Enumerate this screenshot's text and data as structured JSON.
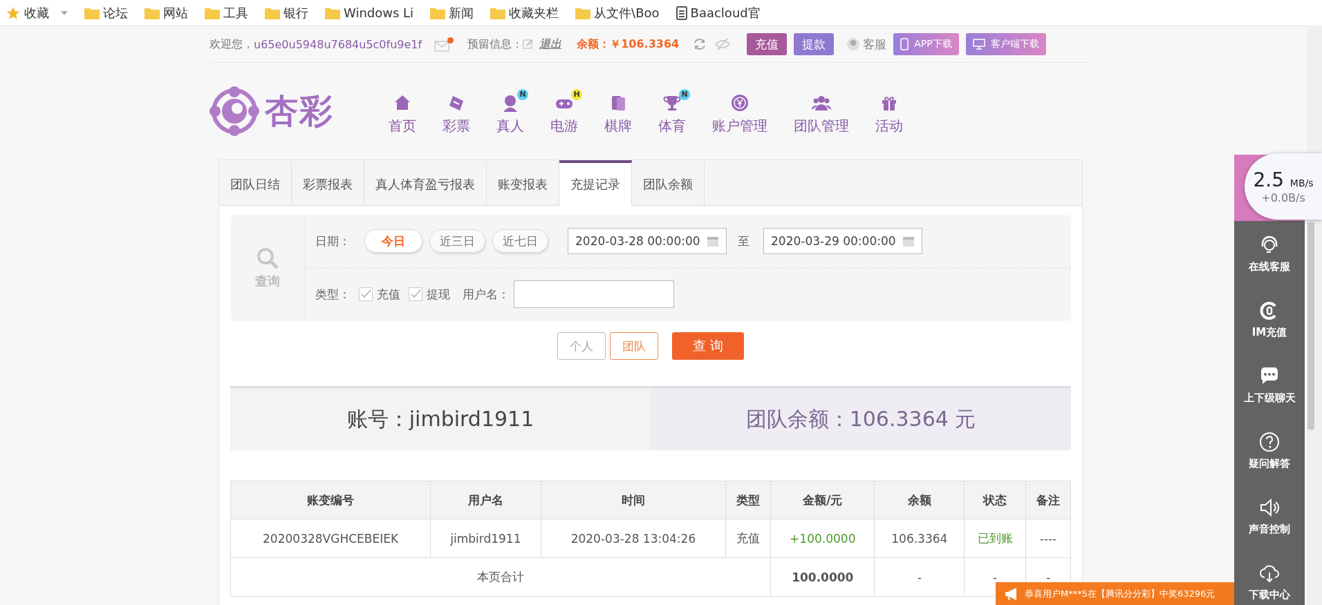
{
  "bookmarks": [
    {
      "kind": "star",
      "label": "收藏",
      "dropdown": true
    },
    {
      "kind": "folder",
      "label": "论坛",
      "dropdown": false
    },
    {
      "kind": "folder",
      "label": "网站",
      "dropdown": false
    },
    {
      "kind": "folder",
      "label": "工具",
      "dropdown": false
    },
    {
      "kind": "folder",
      "label": "银行",
      "dropdown": false
    },
    {
      "kind": "folder",
      "label": "Windows Li",
      "dropdown": false
    },
    {
      "kind": "folder",
      "label": "新闻",
      "dropdown": false
    },
    {
      "kind": "folder",
      "label": "收藏夹栏",
      "dropdown": false
    },
    {
      "kind": "folder",
      "label": "从文件\\Boo",
      "dropdown": false
    },
    {
      "kind": "page",
      "label": "Baacloud官",
      "dropdown": false
    }
  ],
  "header": {
    "welcome": "欢迎您，",
    "username": "u65e0u5948u7684u5c0fu9e1f",
    "mail_unread": true,
    "reserved_label": "预留信息：",
    "logout": "退出",
    "balance_label": "余额：",
    "balance": "￥106.3364",
    "deposit": "充值",
    "withdraw": "提款",
    "service": "客服",
    "app_download": "APP下载",
    "client_download": "客户端下载"
  },
  "logo_text": "杏彩",
  "nav": [
    {
      "label": "首页"
    },
    {
      "label": "彩票"
    },
    {
      "label": "真人",
      "badge": {
        "text": "N",
        "color": "#5bd0f0"
      }
    },
    {
      "label": "电游",
      "badge": {
        "text": "H",
        "color": "#f5e63c"
      }
    },
    {
      "label": "棋牌"
    },
    {
      "label": "体育",
      "badge": {
        "text": "N",
        "color": "#5bd0f0"
      }
    },
    {
      "label": "账户管理"
    },
    {
      "label": "团队管理"
    },
    {
      "label": "活动"
    }
  ],
  "tabs": [
    {
      "label": "团队日结",
      "selected": false
    },
    {
      "label": "彩票报表",
      "selected": false
    },
    {
      "label": "真人体育盈亏报表",
      "selected": false
    },
    {
      "label": "账变报表",
      "selected": false
    },
    {
      "label": "充提记录",
      "selected": true
    },
    {
      "label": "团队余额",
      "selected": false
    }
  ],
  "filter": {
    "search_label": "查询",
    "date_label": "日期：",
    "ranges": [
      {
        "label": "今日",
        "selected": true
      },
      {
        "label": "近三日",
        "selected": false
      },
      {
        "label": "近七日",
        "selected": false
      }
    ],
    "date_from": "2020-03-28 00:00:00",
    "to_label": "至",
    "date_to": "2020-03-29 00:00:00",
    "type_label": "类型：",
    "types": [
      {
        "label": "充值",
        "checked": true
      },
      {
        "label": "提现",
        "checked": true
      }
    ],
    "username_label": "用户名：",
    "scopes": [
      {
        "label": "个人",
        "selected": false
      },
      {
        "label": "团队",
        "selected": true
      }
    ],
    "submit": "查 询"
  },
  "summary": {
    "account": "账号：jimbird1911",
    "team_balance": "团队余额：106.3364 元"
  },
  "table": {
    "columns": [
      "账变编号",
      "用户名",
      "时间",
      "类型",
      "金额/元",
      "余额",
      "状态",
      "备注"
    ],
    "rows": [
      {
        "id": "20200328VGHCEBEIEK",
        "user": "jimbird1911",
        "time": "2020-03-28 13:04:26",
        "type": "充值",
        "amount": "+100.0000",
        "balance": "106.3364",
        "status": "已到账",
        "note": "----"
      }
    ],
    "footer": {
      "label": "本页合计",
      "amount": "100.0000",
      "balance": "-",
      "status": "-",
      "note": "-"
    }
  },
  "side_menu": [
    {
      "label": "在线客服"
    },
    {
      "label": "IM充值"
    },
    {
      "label": "上下级聊天"
    },
    {
      "label": "疑问解答"
    },
    {
      "label": "声音控制"
    },
    {
      "label": "下载中心"
    }
  ],
  "speed_widget": {
    "download": "2.5",
    "unit": "MB/s",
    "upload": "+0.0B/s"
  },
  "toast": "恭喜用户M***5在【腾讯分分彩】中奖63296元"
}
